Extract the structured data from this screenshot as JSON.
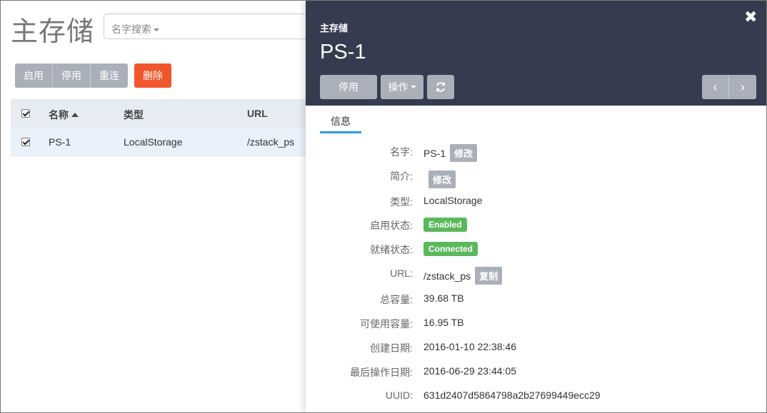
{
  "page": {
    "title": "主存储"
  },
  "search": {
    "dropdown_label": "名字搜索"
  },
  "toolbar": {
    "enable": "启用",
    "disable": "停用",
    "reconnect": "重连",
    "delete": "删除"
  },
  "table": {
    "headers": {
      "name": "名称",
      "type": "类型",
      "url": "URL"
    },
    "rows": [
      {
        "name": "PS-1",
        "type": "LocalStorage",
        "url": "/zstack_ps"
      }
    ]
  },
  "detail": {
    "subtitle": "主存储",
    "title": "PS-1",
    "buttons": {
      "disable": "停用",
      "actions": "操作"
    },
    "tab": "信息",
    "fields": {
      "name": {
        "label": "名字:",
        "value": "PS-1",
        "action": "修改"
      },
      "description": {
        "label": "简介:",
        "value": "",
        "action": "修改"
      },
      "type": {
        "label": "类型:",
        "value": "LocalStorage"
      },
      "state": {
        "label": "启用状态:",
        "value": "Enabled"
      },
      "status": {
        "label": "就绪状态:",
        "value": "Connected"
      },
      "url": {
        "label": "URL:",
        "value": "/zstack_ps",
        "action": "复制"
      },
      "total_capacity": {
        "label": "总容量:",
        "value": "39.68 TB"
      },
      "available_capacity": {
        "label": "可使用容量:",
        "value": "16.95 TB"
      },
      "created": {
        "label": "创建日期:",
        "value": "2016-01-10 22:38:46"
      },
      "last_op": {
        "label": "最后操作日期:",
        "value": "2016-06-29 23:44:05"
      },
      "uuid": {
        "label": "UUID:",
        "value": "631d2407d5864798a2b27699449ecc29"
      }
    }
  },
  "colors": {
    "header_bg": "#353c4f",
    "accent": "#2d9be2",
    "danger": "#f0562b",
    "success": "#5cb85c"
  }
}
